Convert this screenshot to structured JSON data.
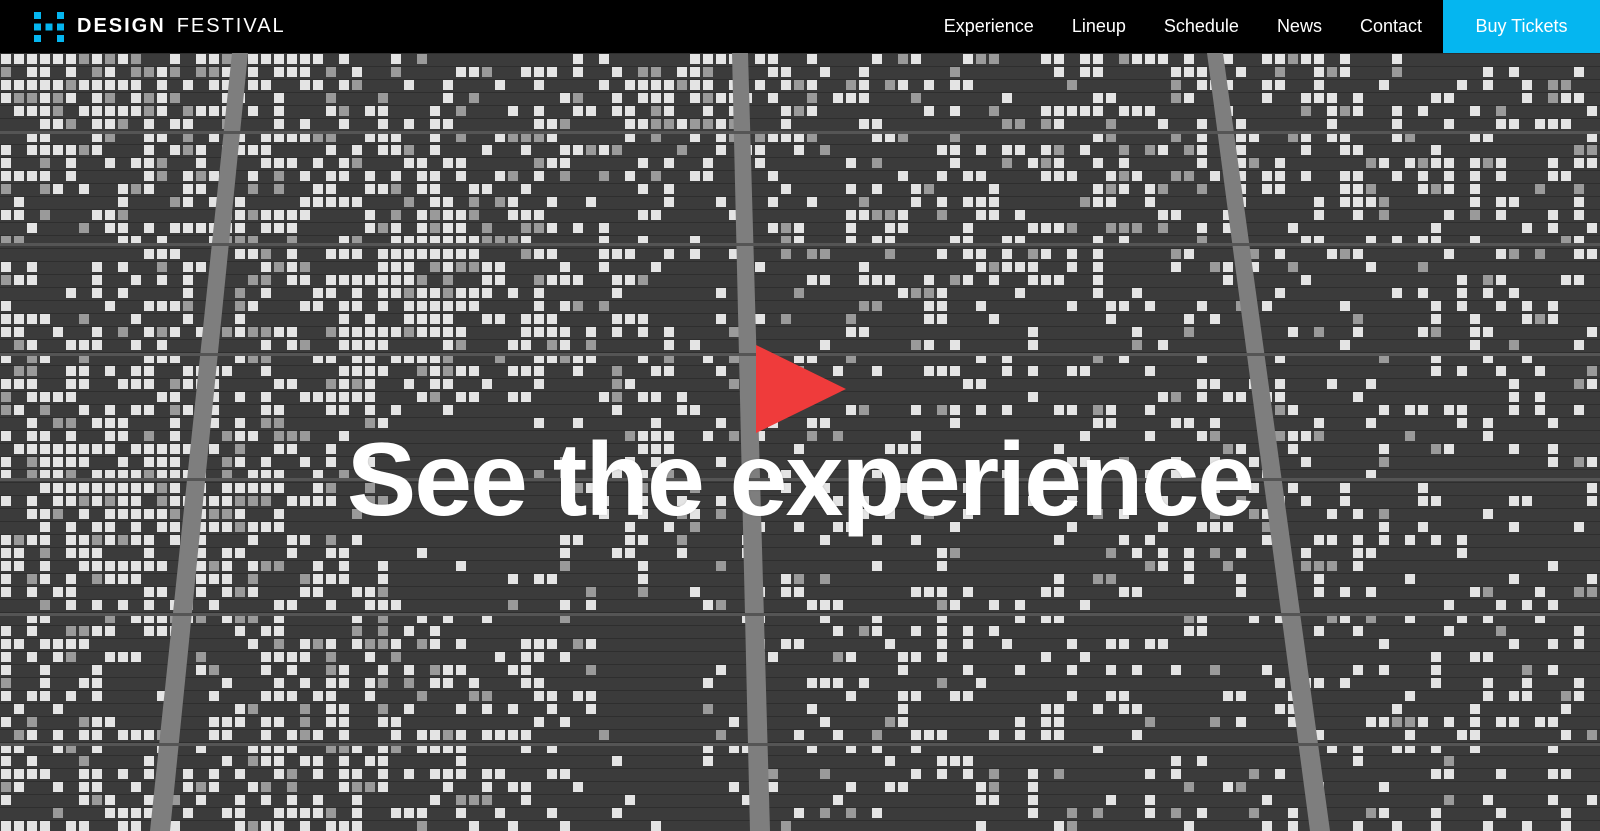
{
  "brand": {
    "name_bold": "DESIGN",
    "name_light": "FESTIVAL",
    "logo_icon": "pixel-h-logo-icon",
    "accent_color": "#05b6f0"
  },
  "nav": {
    "links": [
      {
        "label": "Experience"
      },
      {
        "label": "Lineup"
      },
      {
        "label": "Schedule"
      },
      {
        "label": "News"
      },
      {
        "label": "Contact"
      }
    ],
    "cta_label": "Buy Tickets",
    "cta_color": "#05b6f0"
  },
  "hero": {
    "title": "See the experience",
    "play_icon": "play-icon",
    "play_color": "#ef3b3b",
    "background": "aerial-grid-pixel-mosaic"
  }
}
